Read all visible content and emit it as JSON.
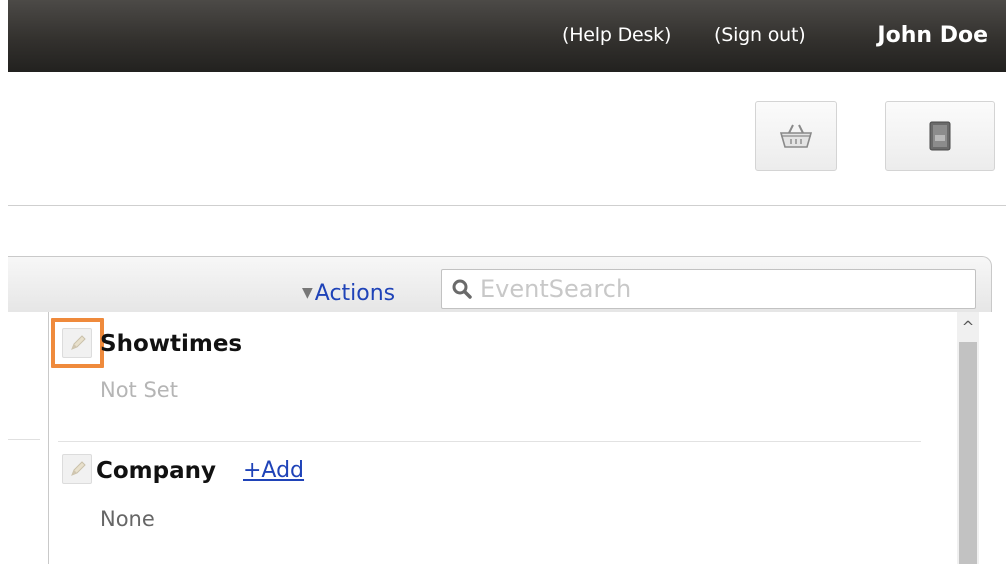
{
  "header": {
    "help_desk": "(Help Desk)",
    "sign_out": "(Sign out)",
    "user_name": "John Doe"
  },
  "toolbar": {
    "basket_icon": "basket-icon",
    "ledger_icon": "ledger-icon"
  },
  "panel": {
    "actions_label": "Actions",
    "search_placeholder": "EventSearch",
    "search_value": ""
  },
  "fields": [
    {
      "label": "Showtimes",
      "value": "Not Set"
    },
    {
      "label": "Company",
      "value": "None",
      "add_label": "+Add"
    }
  ],
  "colors": {
    "link": "#1f43b8",
    "focus": "#ef8a3c",
    "header_bg": "#33312e"
  }
}
